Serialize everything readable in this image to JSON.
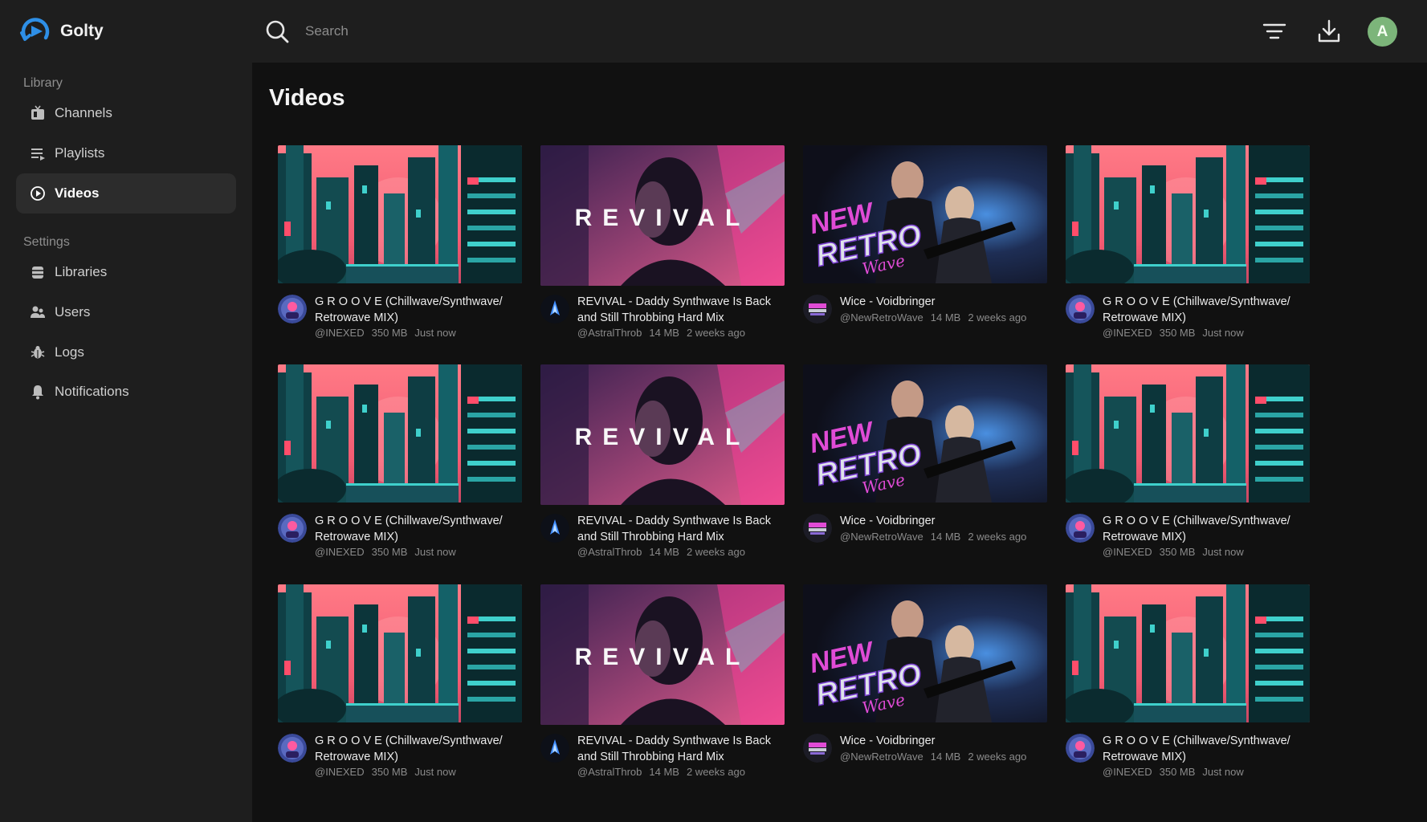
{
  "app": {
    "name": "Golty"
  },
  "search": {
    "placeholder": "Search"
  },
  "user": {
    "initial": "A",
    "avatar_color": "#7cb57a"
  },
  "sidebar": {
    "library_label": "Library",
    "library_items": [
      {
        "label": "Channels",
        "icon": "tv-icon"
      },
      {
        "label": "Playlists",
        "icon": "playlist-icon"
      },
      {
        "label": "Videos",
        "icon": "play-circle-icon",
        "active": true
      }
    ],
    "settings_label": "Settings",
    "settings_items": [
      {
        "label": "Libraries",
        "icon": "database-icon"
      },
      {
        "label": "Users",
        "icon": "users-icon"
      },
      {
        "label": "Logs",
        "icon": "bug-icon"
      },
      {
        "label": "Notifications",
        "icon": "bell-icon"
      }
    ]
  },
  "main": {
    "title": "Videos",
    "videos": [
      {
        "thumb": "groove",
        "title": "G R O O V E (Chillwave/Synthwave/ Retrowave MIX)",
        "channel": "@INEXED",
        "size": "350 MB",
        "age": "Just now"
      },
      {
        "thumb": "revival",
        "thumb_text": "REVIVAL",
        "title": "REVIVAL - Daddy Synthwave Is Back and Still Throbbing Hard Mix",
        "channel": "@AstralThrob",
        "size": "14 MB",
        "age": "2 weeks ago"
      },
      {
        "thumb": "newretro",
        "thumb_text": "NEW RETRO Wave",
        "title": "Wice - Voidbringer",
        "channel": "@NewRetroWave",
        "size": "14 MB",
        "age": "2 weeks ago"
      },
      {
        "thumb": "groove",
        "title": "G R O O V E (Chillwave/Synthwave/ Retrowave MIX)",
        "channel": "@INEXED",
        "size": "350 MB",
        "age": "Just now"
      },
      {
        "thumb": "groove",
        "title": "G R O O V E (Chillwave/Synthwave/ Retrowave MIX)",
        "channel": "@INEXED",
        "size": "350 MB",
        "age": "Just now"
      },
      {
        "thumb": "revival",
        "thumb_text": "REVIVAL",
        "title": "REVIVAL - Daddy Synthwave Is Back and Still Throbbing Hard Mix",
        "channel": "@AstralThrob",
        "size": "14 MB",
        "age": "2 weeks ago"
      },
      {
        "thumb": "newretro",
        "thumb_text": "NEW RETRO Wave",
        "title": "Wice - Voidbringer",
        "channel": "@NewRetroWave",
        "size": "14 MB",
        "age": "2 weeks ago"
      },
      {
        "thumb": "groove",
        "title": "G R O O V E (Chillwave/Synthwave/ Retrowave MIX)",
        "channel": "@INEXED",
        "size": "350 MB",
        "age": "Just now"
      },
      {
        "thumb": "groove",
        "title": "G R O O V E (Chillwave/Synthwave/ Retrowave MIX)",
        "channel": "@INEXED",
        "size": "350 MB",
        "age": "Just now"
      },
      {
        "thumb": "revival",
        "thumb_text": "REVIVAL",
        "title": "REVIVAL - Daddy Synthwave Is Back and Still Throbbing Hard Mix",
        "channel": "@AstralThrob",
        "size": "14 MB",
        "age": "2 weeks ago"
      },
      {
        "thumb": "newretro",
        "thumb_text": "NEW RETRO Wave",
        "title": "Wice - Voidbringer",
        "channel": "@NewRetroWave",
        "size": "14 MB",
        "age": "2 weeks ago"
      },
      {
        "thumb": "groove",
        "title": "G R O O V E (Chillwave/Synthwave/ Retrowave MIX)",
        "channel": "@INEXED",
        "size": "350 MB",
        "age": "Just now"
      }
    ]
  },
  "colors": {
    "background": "#111111",
    "panel": "#1e1e1e",
    "active_nav": "#2c2c2c",
    "brand_blue": "#2e8fe6"
  }
}
